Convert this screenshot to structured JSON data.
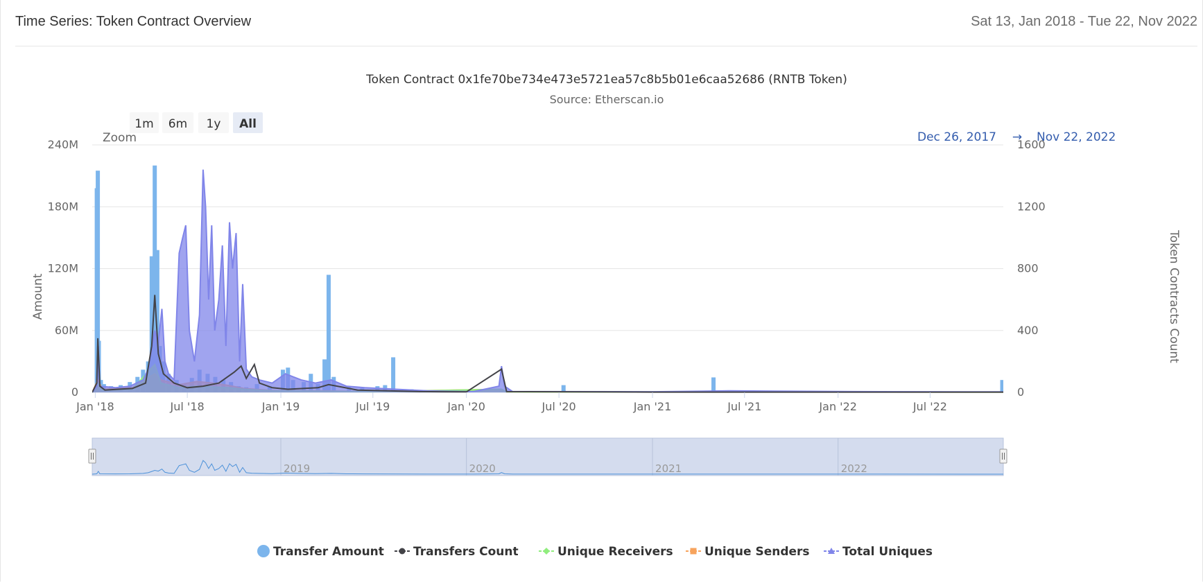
{
  "header": {
    "title": "Time Series: Token Contract Overview",
    "date_range": "Sat 13, Jan 2018 - Tue 22, Nov 2022"
  },
  "chart_data": {
    "type": "area",
    "title": "Token Contract 0x1fe70be734e473e5721ea57c8b5b01e6caa52686 (RNTB Token)",
    "subtitle": "Source: Etherscan.io",
    "zoom": {
      "label": "Zoom",
      "buttons": [
        "1m",
        "6m",
        "1y",
        "All"
      ],
      "selected": "All"
    },
    "range_display": {
      "from": "Dec 26, 2017",
      "arrow": "→",
      "to": "Nov 22, 2022"
    },
    "x_axis": {
      "type": "datetime",
      "min": "2017-12-26",
      "max": "2022-11-22",
      "ticks": [
        {
          "date": "2018-01-01",
          "label": "Jan '18"
        },
        {
          "date": "2018-07-01",
          "label": "Jul '18"
        },
        {
          "date": "2019-01-01",
          "label": "Jan '19"
        },
        {
          "date": "2019-07-01",
          "label": "Jul '19"
        },
        {
          "date": "2020-01-01",
          "label": "Jan '20"
        },
        {
          "date": "2020-07-01",
          "label": "Jul '20"
        },
        {
          "date": "2021-01-01",
          "label": "Jan '21"
        },
        {
          "date": "2021-07-01",
          "label": "Jul '21"
        },
        {
          "date": "2022-01-01",
          "label": "Jan '22"
        },
        {
          "date": "2022-07-01",
          "label": "Jul '22"
        }
      ]
    },
    "y_left": {
      "label": "Amount",
      "min": 0,
      "max": 240000000,
      "ticks": [
        {
          "value": 0,
          "label": "0"
        },
        {
          "value": 60000000,
          "label": "60M"
        },
        {
          "value": 120000000,
          "label": "120M"
        },
        {
          "value": 180000000,
          "label": "180M"
        },
        {
          "value": 240000000,
          "label": "240M"
        }
      ]
    },
    "y_right": {
      "label": "Token Contracts Count",
      "min": 0,
      "max": 1600,
      "ticks": [
        {
          "value": 0,
          "label": "0"
        },
        {
          "value": 400,
          "label": "400"
        },
        {
          "value": 800,
          "label": "800"
        },
        {
          "value": 1200,
          "label": "1200"
        },
        {
          "value": 1600,
          "label": "1600"
        }
      ]
    },
    "grid": true,
    "legend_position": "bottom-center",
    "navigator": {
      "year_labels": [
        {
          "date": "2019-01-01",
          "label": "2019"
        },
        {
          "date": "2020-01-01",
          "label": "2020"
        },
        {
          "date": "2021-01-01",
          "label": "2021"
        },
        {
          "date": "2022-01-01",
          "label": "2022"
        }
      ]
    },
    "series": [
      {
        "name": "Transfer Amount",
        "axis": "left",
        "kind": "column",
        "color": "#7cb5ec",
        "legend_symbol": "circle",
        "points": [
          [
            "2018-01-04",
            198000000
          ],
          [
            "2018-01-06",
            215000000
          ],
          [
            "2018-01-08",
            50000000
          ],
          [
            "2018-01-12",
            12000000
          ],
          [
            "2018-01-18",
            8000000
          ],
          [
            "2018-02-01",
            6000000
          ],
          [
            "2018-02-20",
            7000000
          ],
          [
            "2018-03-10",
            10000000
          ],
          [
            "2018-03-25",
            15000000
          ],
          [
            "2018-04-05",
            22000000
          ],
          [
            "2018-04-15",
            30000000
          ],
          [
            "2018-04-22",
            132000000
          ],
          [
            "2018-04-28",
            220000000
          ],
          [
            "2018-05-03",
            138000000
          ],
          [
            "2018-05-08",
            45000000
          ],
          [
            "2018-05-15",
            30000000
          ],
          [
            "2018-05-25",
            18000000
          ],
          [
            "2018-06-10",
            12000000
          ],
          [
            "2018-06-25",
            8000000
          ],
          [
            "2018-07-10",
            14000000
          ],
          [
            "2018-07-25",
            22000000
          ],
          [
            "2018-08-10",
            18000000
          ],
          [
            "2018-08-25",
            15000000
          ],
          [
            "2018-09-10",
            12000000
          ],
          [
            "2018-09-25",
            10000000
          ],
          [
            "2018-10-10",
            6000000
          ],
          [
            "2018-10-25",
            5000000
          ],
          [
            "2018-11-15",
            8000000
          ],
          [
            "2018-12-10",
            6000000
          ],
          [
            "2019-01-05",
            22000000
          ],
          [
            "2019-01-15",
            24000000
          ],
          [
            "2019-01-25",
            12000000
          ],
          [
            "2019-02-15",
            10000000
          ],
          [
            "2019-03-01",
            18000000
          ],
          [
            "2019-03-15",
            8000000
          ],
          [
            "2019-03-28",
            32000000
          ],
          [
            "2019-04-05",
            114000000
          ],
          [
            "2019-04-15",
            15000000
          ],
          [
            "2019-05-15",
            5000000
          ],
          [
            "2019-06-10",
            4000000
          ],
          [
            "2019-07-10",
            6000000
          ],
          [
            "2019-07-25",
            7000000
          ],
          [
            "2019-08-10",
            34000000
          ],
          [
            "2019-09-15",
            3000000
          ],
          [
            "2019-10-25",
            2000000
          ],
          [
            "2020-03-10",
            1000000
          ],
          [
            "2020-07-10",
            7000000
          ],
          [
            "2020-11-10",
            1000000
          ],
          [
            "2021-05-01",
            14500000
          ],
          [
            "2022-01-10",
            1000000
          ],
          [
            "2022-11-20",
            12000000
          ]
        ]
      },
      {
        "name": "Transfers Count",
        "axis": "right",
        "kind": "line",
        "color": "#434348",
        "legend_symbol": "circle-line",
        "points": [
          [
            "2017-12-26",
            0
          ],
          [
            "2018-01-04",
            60
          ],
          [
            "2018-01-06",
            350
          ],
          [
            "2018-01-10",
            40
          ],
          [
            "2018-01-20",
            15
          ],
          [
            "2018-02-15",
            20
          ],
          [
            "2018-03-15",
            25
          ],
          [
            "2018-04-10",
            60
          ],
          [
            "2018-04-22",
            300
          ],
          [
            "2018-04-28",
            630
          ],
          [
            "2018-05-05",
            250
          ],
          [
            "2018-05-15",
            120
          ],
          [
            "2018-06-05",
            60
          ],
          [
            "2018-07-01",
            30
          ],
          [
            "2018-08-01",
            40
          ],
          [
            "2018-09-01",
            60
          ],
          [
            "2018-10-01",
            130
          ],
          [
            "2018-10-15",
            170
          ],
          [
            "2018-10-25",
            90
          ],
          [
            "2018-11-10",
            180
          ],
          [
            "2018-11-20",
            60
          ],
          [
            "2018-12-15",
            30
          ],
          [
            "2019-01-15",
            20
          ],
          [
            "2019-03-15",
            30
          ],
          [
            "2019-04-05",
            50
          ],
          [
            "2019-06-01",
            15
          ],
          [
            "2019-08-01",
            10
          ],
          [
            "2019-10-01",
            5
          ],
          [
            "2020-01-01",
            3
          ],
          [
            "2020-03-10",
            150
          ],
          [
            "2020-03-20",
            5
          ],
          [
            "2021-01-01",
            2
          ],
          [
            "2022-11-22",
            2
          ]
        ]
      },
      {
        "name": "Unique Receivers",
        "axis": "right",
        "kind": "area",
        "color": "#90ed7d",
        "legend_symbol": "diamond-line",
        "points": [
          [
            "2017-12-26",
            0
          ],
          [
            "2018-01-06",
            60
          ],
          [
            "2018-01-15",
            15
          ],
          [
            "2018-03-15",
            20
          ],
          [
            "2018-04-28",
            180
          ],
          [
            "2018-05-10",
            60
          ],
          [
            "2018-06-15",
            30
          ],
          [
            "2018-07-20",
            40
          ],
          [
            "2018-08-20",
            35
          ],
          [
            "2018-09-20",
            30
          ],
          [
            "2018-10-20",
            20
          ],
          [
            "2018-12-15",
            10
          ],
          [
            "2019-03-15",
            8
          ],
          [
            "2019-07-01",
            4
          ],
          [
            "2020-03-10",
            20
          ],
          [
            "2020-03-20",
            3
          ],
          [
            "2022-11-22",
            2
          ]
        ]
      },
      {
        "name": "Unique Senders",
        "axis": "right",
        "kind": "area",
        "color": "#f7a35c",
        "legend_symbol": "square-line",
        "points": [
          [
            "2017-12-26",
            0
          ],
          [
            "2018-01-06",
            80
          ],
          [
            "2018-01-15",
            20
          ],
          [
            "2018-03-15",
            30
          ],
          [
            "2018-04-28",
            120
          ],
          [
            "2018-05-10",
            80
          ],
          [
            "2018-06-15",
            50
          ],
          [
            "2018-07-20",
            70
          ],
          [
            "2018-08-20",
            60
          ],
          [
            "2018-09-20",
            45
          ],
          [
            "2018-10-20",
            25
          ],
          [
            "2018-12-15",
            12
          ],
          [
            "2019-03-15",
            10
          ],
          [
            "2019-07-01",
            5
          ],
          [
            "2020-03-10",
            20
          ],
          [
            "2020-03-20",
            3
          ],
          [
            "2022-11-22",
            2
          ]
        ]
      },
      {
        "name": "Total Uniques",
        "axis": "right",
        "kind": "area",
        "color": "#8085e9",
        "legend_symbol": "triangle-line",
        "points": [
          [
            "2017-12-26",
            0
          ],
          [
            "2018-01-04",
            40
          ],
          [
            "2018-01-07",
            300
          ],
          [
            "2018-01-10",
            40
          ],
          [
            "2018-02-10",
            30
          ],
          [
            "2018-03-10",
            40
          ],
          [
            "2018-04-05",
            80
          ],
          [
            "2018-04-15",
            150
          ],
          [
            "2018-04-22",
            280
          ],
          [
            "2018-04-28",
            400
          ],
          [
            "2018-05-05",
            320
          ],
          [
            "2018-05-12",
            540
          ],
          [
            "2018-05-18",
            200
          ],
          [
            "2018-05-25",
            120
          ],
          [
            "2018-06-05",
            80
          ],
          [
            "2018-06-15",
            900
          ],
          [
            "2018-06-22",
            1000
          ],
          [
            "2018-06-28",
            1080
          ],
          [
            "2018-07-05",
            400
          ],
          [
            "2018-07-15",
            200
          ],
          [
            "2018-07-25",
            500
          ],
          [
            "2018-08-01",
            1440
          ],
          [
            "2018-08-06",
            1200
          ],
          [
            "2018-08-12",
            600
          ],
          [
            "2018-08-18",
            1080
          ],
          [
            "2018-08-24",
            400
          ],
          [
            "2018-09-01",
            600
          ],
          [
            "2018-09-08",
            950
          ],
          [
            "2018-09-15",
            300
          ],
          [
            "2018-09-22",
            1100
          ],
          [
            "2018-09-28",
            800
          ],
          [
            "2018-10-05",
            1030
          ],
          [
            "2018-10-12",
            200
          ],
          [
            "2018-10-18",
            700
          ],
          [
            "2018-10-25",
            150
          ],
          [
            "2018-11-05",
            100
          ],
          [
            "2018-11-20",
            80
          ],
          [
            "2018-12-15",
            60
          ],
          [
            "2019-01-10",
            120
          ],
          [
            "2019-02-10",
            80
          ],
          [
            "2019-03-10",
            60
          ],
          [
            "2019-04-10",
            80
          ],
          [
            "2019-05-10",
            40
          ],
          [
            "2019-06-15",
            30
          ],
          [
            "2019-08-15",
            20
          ],
          [
            "2019-10-15",
            10
          ],
          [
            "2020-01-15",
            5
          ],
          [
            "2020-03-05",
            40
          ],
          [
            "2020-03-10",
            170
          ],
          [
            "2020-03-16",
            40
          ],
          [
            "2020-04-01",
            5
          ],
          [
            "2021-01-01",
            4
          ],
          [
            "2021-06-01",
            10
          ],
          [
            "2021-09-01",
            8
          ],
          [
            "2022-02-01",
            5
          ],
          [
            "2022-11-22",
            3
          ]
        ]
      }
    ]
  }
}
